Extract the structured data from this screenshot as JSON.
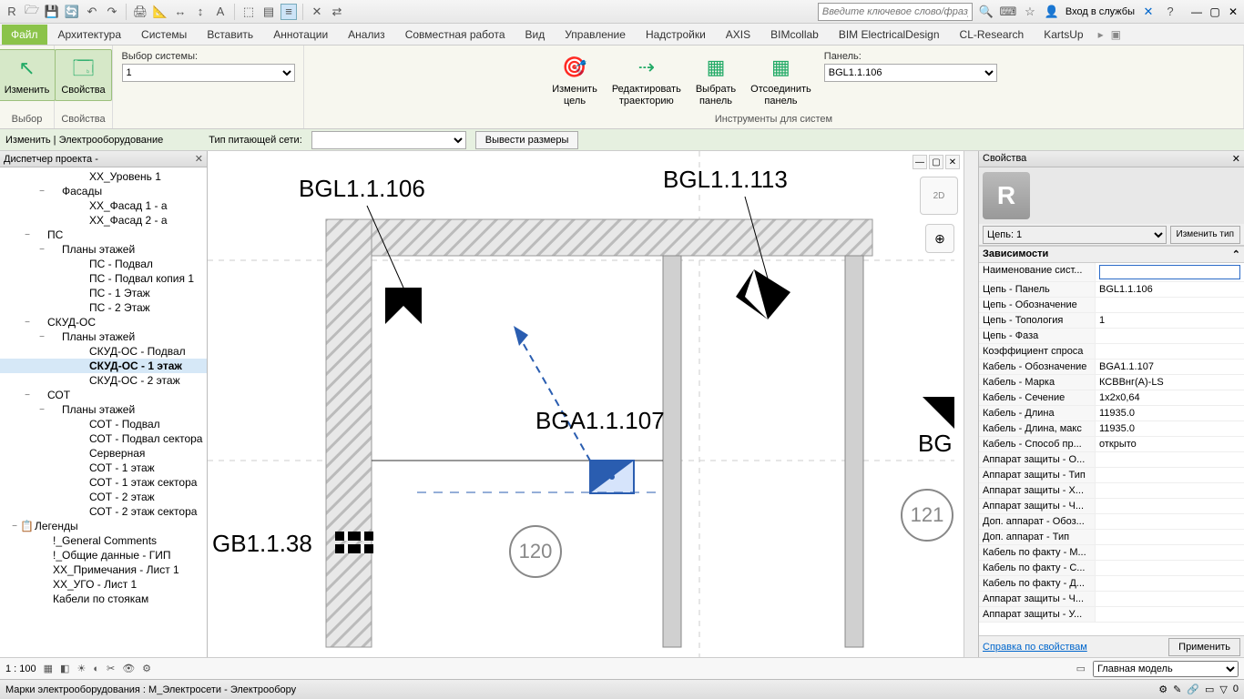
{
  "search_placeholder": "Введите ключевое слово/фразу",
  "login_text": "Вход в службы",
  "ribbon_tabs": {
    "file": "Файл",
    "t1": "Архитектура",
    "t2": "Системы",
    "t3": "Вставить",
    "t4": "Аннотации",
    "t5": "Анализ",
    "t6": "Совместная работа",
    "t7": "Вид",
    "t8": "Управление",
    "t9": "Надстройки",
    "t10": "AXIS",
    "t11": "BIMcollab",
    "t12": "BIM ElectricalDesign",
    "t13": "CL-Research",
    "t14": "KartsUp"
  },
  "ribbon": {
    "g1": "Выбор",
    "g2": "Свойства",
    "g3": "Инструменты для систем",
    "btn_modify": "Изменить",
    "btn_props": "Свойства",
    "sys_label": "Выбор системы:",
    "sys_value": "1",
    "btn_mod_goal": "Изменить\nцель",
    "btn_edit_path": "Редактировать\nтраекторию",
    "btn_sel_panel": "Выбрать\nпанель",
    "btn_detach": "Отсоединить\nпанель",
    "panel_label": "Панель:",
    "panel_value": "BGL1.1.106"
  },
  "secbar": {
    "context": "Изменить | Электрооборудование",
    "net_label": "Тип питающей сети:",
    "btn_dims": "Вывести размеры"
  },
  "browser": {
    "title": "Диспетчер проекта -",
    "nodes": [
      {
        "pad": 70,
        "exp": "",
        "txt": "XX_Уровень 1"
      },
      {
        "pad": 40,
        "exp": "−",
        "txt": "Фасады"
      },
      {
        "pad": 70,
        "exp": "",
        "txt": "XX_Фасад 1 - а"
      },
      {
        "pad": 70,
        "exp": "",
        "txt": "XX_Фасад 2 - а"
      },
      {
        "pad": 24,
        "exp": "−",
        "txt": "ПС"
      },
      {
        "pad": 40,
        "exp": "−",
        "txt": "Планы этажей"
      },
      {
        "pad": 70,
        "exp": "",
        "txt": "ПС - Подвал"
      },
      {
        "pad": 70,
        "exp": "",
        "txt": "ПС - Подвал копия 1"
      },
      {
        "pad": 70,
        "exp": "",
        "txt": "ПС - 1 Этаж"
      },
      {
        "pad": 70,
        "exp": "",
        "txt": "ПС - 2 Этаж"
      },
      {
        "pad": 24,
        "exp": "−",
        "txt": "СКУД-ОС"
      },
      {
        "pad": 40,
        "exp": "−",
        "txt": "Планы этажей"
      },
      {
        "pad": 70,
        "exp": "",
        "txt": "СКУД-ОС - Подвал"
      },
      {
        "pad": 70,
        "exp": "",
        "txt": "СКУД-ОС - 1 этаж",
        "sel": true
      },
      {
        "pad": 70,
        "exp": "",
        "txt": "СКУД-ОС - 2 этаж"
      },
      {
        "pad": 24,
        "exp": "−",
        "txt": "СОТ"
      },
      {
        "pad": 40,
        "exp": "−",
        "txt": "Планы этажей"
      },
      {
        "pad": 70,
        "exp": "",
        "txt": "СОТ - Подвал"
      },
      {
        "pad": 70,
        "exp": "",
        "txt": "СОТ - Подвал сектора"
      },
      {
        "pad": 70,
        "exp": "",
        "txt": "Серверная"
      },
      {
        "pad": 70,
        "exp": "",
        "txt": "СОТ - 1 этаж"
      },
      {
        "pad": 70,
        "exp": "",
        "txt": "СОТ - 1 этаж сектора"
      },
      {
        "pad": 70,
        "exp": "",
        "txt": "СОТ - 2 этаж"
      },
      {
        "pad": 70,
        "exp": "",
        "txt": "СОТ - 2 этаж сектора"
      },
      {
        "pad": 10,
        "exp": "−",
        "txt": "Легенды",
        "ic": "📋"
      },
      {
        "pad": 30,
        "exp": "",
        "txt": "!_General Comments"
      },
      {
        "pad": 30,
        "exp": "",
        "txt": "!_Общие данные - ГИП"
      },
      {
        "pad": 30,
        "exp": "",
        "txt": "XX_Примечания - Лист 1"
      },
      {
        "pad": 30,
        "exp": "",
        "txt": "XX_УГО - Лист 1"
      },
      {
        "pad": 30,
        "exp": "",
        "txt": "Кабели по стоякам"
      }
    ]
  },
  "canvas": {
    "lbl1": "BGL1.1.106",
    "lbl2": "BGL1.1.113",
    "lbl3": "BGA1.1.107",
    "lbl4": "GB1.1.38",
    "lbl5": "BG",
    "room1": "120",
    "room2": "121"
  },
  "props": {
    "title": "Свойства",
    "type_sel": "Цепь: 1",
    "edit_type": "Изменить тип",
    "cat1": "Зависимости",
    "rows": [
      {
        "k": "Наименование сист...",
        "v": ""
      },
      {
        "k": "Цепь - Панель",
        "v": "BGL1.1.106"
      },
      {
        "k": "Цепь - Обозначение",
        "v": ""
      },
      {
        "k": "Цепь - Топология",
        "v": "1"
      },
      {
        "k": "Цепь - Фаза",
        "v": ""
      },
      {
        "k": "Коэффициент спроса",
        "v": ""
      },
      {
        "k": "Кабель - Обозначение",
        "v": "BGA1.1.107"
      },
      {
        "k": "Кабель - Марка",
        "v": "КСВВнг(А)-LS"
      },
      {
        "k": "Кабель - Сечение",
        "v": "1x2x0,64"
      },
      {
        "k": "Кабель - Длина",
        "v": "11935.0"
      },
      {
        "k": "Кабель - Длина, макс",
        "v": "11935.0"
      },
      {
        "k": "Кабель - Способ пр...",
        "v": "открыто"
      },
      {
        "k": "Аппарат защиты - О...",
        "v": ""
      },
      {
        "k": "Аппарат защиты - Тип",
        "v": ""
      },
      {
        "k": "Аппарат защиты - Х...",
        "v": ""
      },
      {
        "k": "Аппарат защиты - Ч...",
        "v": ""
      },
      {
        "k": "Доп. аппарат - Обоз...",
        "v": ""
      },
      {
        "k": "Доп. аппарат - Тип",
        "v": ""
      },
      {
        "k": "Кабель по факту - М...",
        "v": ""
      },
      {
        "k": "Кабель по факту - С...",
        "v": ""
      },
      {
        "k": "Кабель по факту - Д...",
        "v": ""
      },
      {
        "k": "Аппарат защиты - Ч...",
        "v": ""
      },
      {
        "k": "Аппарат защиты - У...",
        "v": ""
      }
    ],
    "help": "Справка по свойствам",
    "apply": "Применить"
  },
  "viewbar": {
    "scale": "1 : 100"
  },
  "status": {
    "left": "Марки электрооборудования : М_Электросети - Электрообору",
    "model": "Главная модель"
  }
}
